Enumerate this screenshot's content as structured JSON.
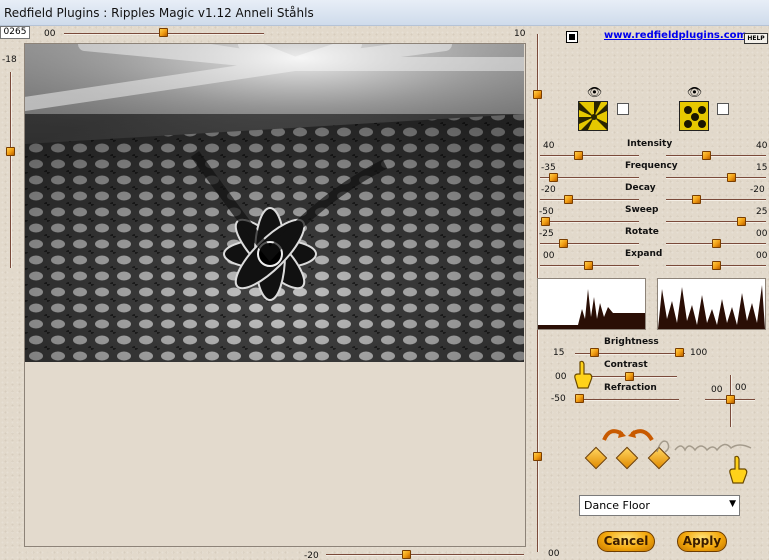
{
  "window": {
    "title": "Redfield Plugins : Ripples Magic v1.12   Anneli Ståhls"
  },
  "top_controls": {
    "value_box": "0265",
    "top_slider_label": "00",
    "top_slider_value": 10,
    "left_slider_label": "-18",
    "bottom_slider_label": "-20",
    "right_vertical_label": "10",
    "right_vertical_bottom_label": "00"
  },
  "header_right": {
    "website_link": "www.redfieldplugins.com",
    "help_label": "HELP"
  },
  "sliders": [
    {
      "name": "Intensity",
      "left_value": "40",
      "right_value": "40"
    },
    {
      "name": "Frequency",
      "left_value": "-35",
      "right_value": "15"
    },
    {
      "name": "Decay",
      "left_value": "-20",
      "right_value": "-20"
    },
    {
      "name": "Sweep",
      "left_value": "-50",
      "right_value": "25"
    },
    {
      "name": "Rotate",
      "left_value": "-25",
      "right_value": "00"
    },
    {
      "name": "Expand",
      "left_value": "00",
      "right_value": "00"
    }
  ],
  "lighting": {
    "brightness": {
      "label": "Brightness",
      "left_value": "15",
      "right_value": "100"
    },
    "contrast": {
      "label": "Contrast",
      "left_value": "00"
    },
    "refraction": {
      "label": "Refraction",
      "left_value": "-50"
    },
    "small_slider_left": "00",
    "small_slider_right": "00"
  },
  "signature": "Anneli",
  "preset": {
    "selected": "Dance Floor"
  },
  "buttons": {
    "cancel": "Cancel",
    "apply": "Apply"
  },
  "colors": {
    "background": "#e2d9cb",
    "accent": "#f09a10",
    "link": "#0000ee"
  }
}
